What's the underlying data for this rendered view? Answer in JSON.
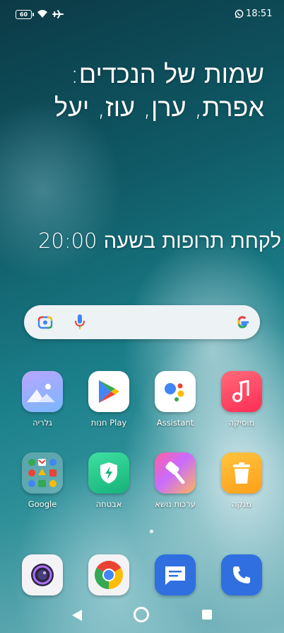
{
  "status_bar": {
    "battery_level": "60",
    "time": "18:51",
    "icons": [
      "battery-icon",
      "wifi-icon",
      "airplane-mode-icon",
      "whatsapp-notification-icon"
    ]
  },
  "widgets": {
    "note_title": "שמות של הנכדים:",
    "note_names": "אפרת, ערן, עוז, יעל",
    "reminder": "לקחת תרופות בשעה 20:00"
  },
  "search_bar": {
    "icons": [
      "google-lens-icon",
      "microphone-icon",
      "google-logo-icon"
    ]
  },
  "apps": {
    "row1": [
      {
        "label": "גלריה",
        "icon": "gallery-icon"
      },
      {
        "label": "חנות Play",
        "icon": "play-store-icon"
      },
      {
        "label": "Assistant",
        "icon": "google-assistant-icon"
      },
      {
        "label": "מוסיקה",
        "icon": "music-icon"
      }
    ],
    "row2": [
      {
        "label": "Google",
        "icon": "google-folder-icon"
      },
      {
        "label": "אבטחה",
        "icon": "security-icon"
      },
      {
        "label": "ערכות נושא",
        "icon": "themes-icon"
      },
      {
        "label": "מנקה",
        "icon": "cleaner-icon"
      }
    ]
  },
  "dock": [
    "camera-icon",
    "chrome-icon",
    "messages-icon",
    "phone-icon"
  ],
  "page_indicator": {
    "pages": 1,
    "current": 1
  },
  "nav_bar": {
    "icons": [
      "back-icon",
      "home-icon",
      "recents-icon"
    ]
  }
}
